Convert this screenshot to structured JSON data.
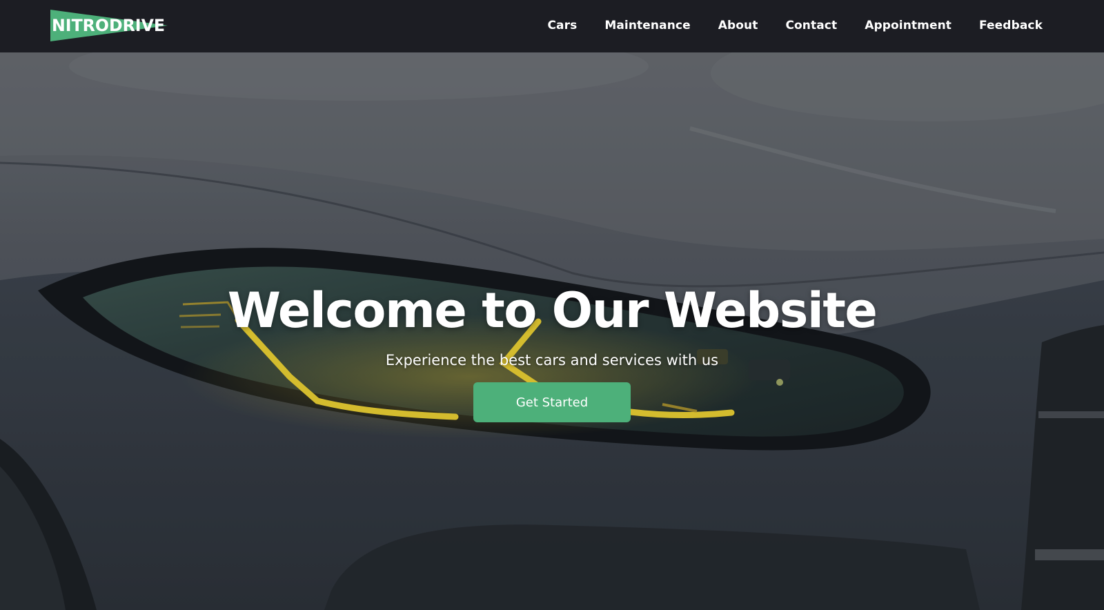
{
  "brand": {
    "name": "NITRODRIVE",
    "accent_color": "#4db07a",
    "nav_bg": "#1c1d23"
  },
  "nav": {
    "items": [
      {
        "label": "Cars"
      },
      {
        "label": "Maintenance"
      },
      {
        "label": "About"
      },
      {
        "label": "Contact"
      },
      {
        "label": "Appointment"
      },
      {
        "label": "Feedback"
      }
    ]
  },
  "hero": {
    "title": "Welcome to Our Website",
    "subtitle": "Experience the best cars and services with us",
    "cta_label": "Get Started",
    "background": "car-headlight-photo"
  }
}
